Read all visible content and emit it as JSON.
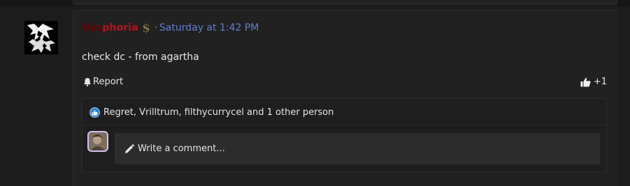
{
  "post": {
    "username_part1": "Dys",
    "username_part2": "phoria",
    "separator": "·",
    "timestamp": "Saturday at 1:42 PM",
    "message": "check dc - from agartha",
    "actions": {
      "report_label": "Report",
      "like_count": "+1"
    },
    "reactions": {
      "text": "Regret, Vrilltrum, filthycurrycel and 1 other person"
    },
    "comment": {
      "placeholder": "Write a comment..."
    }
  },
  "icons": {
    "report": "bell-icon",
    "like": "thumbs-up-icon",
    "reaction": "like-reaction-icon",
    "comment": "pencil-icon",
    "badge": "dollar-badge-icon"
  },
  "colors": {
    "background": "#1c1c1c",
    "card": "#212121",
    "username_dark": "#6b0000",
    "username_red": "#b0141a",
    "timestamp": "#5f7ec9",
    "reaction_blue": "#2f86d6",
    "comment_box": "#2c2c2c"
  }
}
